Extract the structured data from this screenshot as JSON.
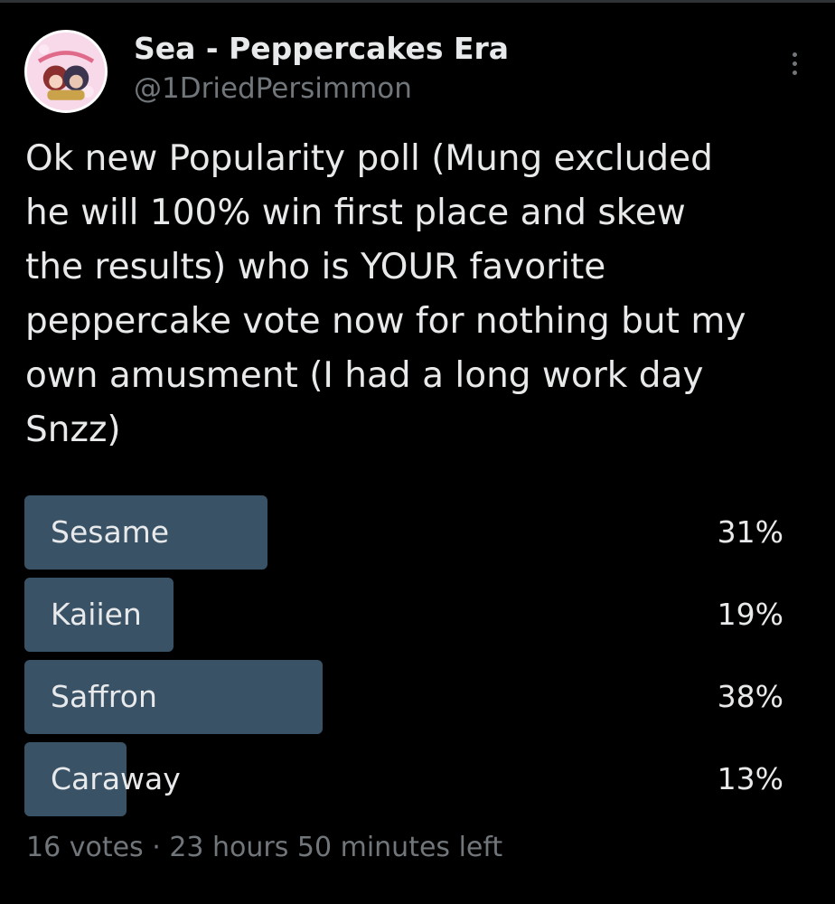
{
  "author": {
    "display_name": "Sea - Peppercakes Era",
    "handle": "@1DriedPersimmon",
    "avatar_icon": "profile-avatar-image"
  },
  "tweet": {
    "text": "Ok new Popularity poll (Mung excluded\nhe will 100% win first place and skew\nthe results) who is YOUR favorite\npeppercake vote now for nothing but my\nown amusment (I had a long work day\nSnzz)"
  },
  "poll": {
    "options": [
      {
        "label": "Sesame",
        "percent_text": "31%",
        "percent": 31
      },
      {
        "label": "Kaiien",
        "percent_text": "19%",
        "percent": 19
      },
      {
        "label": "Saffron",
        "percent_text": "38%",
        "percent": 38
      },
      {
        "label": "Caraway",
        "percent_text": "13%",
        "percent": 13
      }
    ],
    "votes": "16 votes",
    "separator": "·",
    "time_left": "23 hours 50 minutes left"
  },
  "colors": {
    "background": "#000000",
    "text_primary": "#e7e9ea",
    "text_secondary": "#71767b",
    "poll_bar": "#3a5266"
  },
  "icons": {
    "more": "more-options-icon"
  }
}
